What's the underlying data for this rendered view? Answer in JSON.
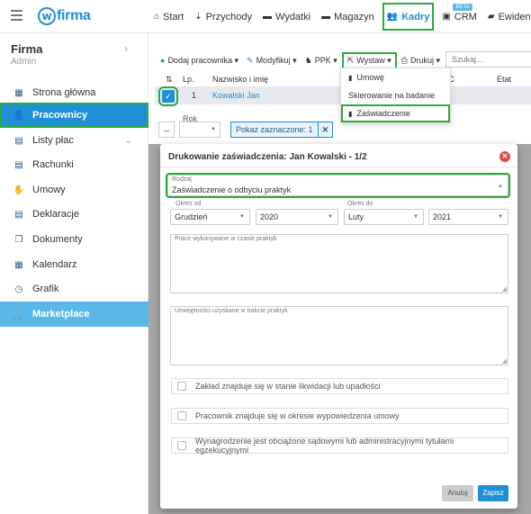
{
  "logo": {
    "text": "firma"
  },
  "topnav": [
    {
      "label": "Start",
      "icon": "home-icon",
      "glyph": "⌂"
    },
    {
      "label": "Przychody",
      "icon": "income-icon",
      "glyph": "⇣"
    },
    {
      "label": "Wydatki",
      "icon": "expenses-icon",
      "glyph": "▬"
    },
    {
      "label": "Magazyn",
      "icon": "warehouse-icon",
      "glyph": "▬"
    },
    {
      "label": "Kadry",
      "icon": "users-icon",
      "glyph": "👥"
    },
    {
      "label": "CRM",
      "icon": "crm-icon",
      "glyph": "▣"
    },
    {
      "label": "Ewidencje",
      "icon": "folder-icon",
      "glyph": "▰"
    }
  ],
  "beta_label": "BETA",
  "sidebar": {
    "company": "Firma",
    "role": "Admin",
    "items": [
      {
        "label": "Strona główna",
        "glyph": "▦"
      },
      {
        "label": "Pracownicy",
        "glyph": "👤"
      },
      {
        "label": "Listy płac",
        "glyph": "▤"
      },
      {
        "label": "Rachunki",
        "glyph": "▤"
      },
      {
        "label": "Umowy",
        "glyph": "✋"
      },
      {
        "label": "Deklaracje",
        "glyph": "▤"
      },
      {
        "label": "Dokumenty",
        "glyph": "❐"
      },
      {
        "label": "Kalendarz",
        "glyph": "▦"
      },
      {
        "label": "Grafik",
        "glyph": "◷"
      },
      {
        "label": "Marketplace",
        "glyph": "🛒"
      }
    ]
  },
  "toolbar": {
    "add_employee": "Dodaj pracownika",
    "modify": "Modyfikuj",
    "ppk": "PPK",
    "issue": "Wystaw",
    "print": "Drukuj",
    "search_placeholder": "Szukaj..."
  },
  "issue_menu": [
    "Umowę",
    "Skierowanie na badanie",
    "Zaświadczenie"
  ],
  "table": {
    "headers": [
      "Lp.",
      "Nazwisko i imię",
      "Etat"
    ],
    "c_partial": "C",
    "rows": [
      {
        "lp": "1",
        "name": "Kowalski Jan"
      }
    ]
  },
  "filters": {
    "year_label": "Rok",
    "show_selected": "Pokaż zaznaczone: 1"
  },
  "modal": {
    "title": "Drukowanie zaświadczenia: Jan Kowalski - 1/2",
    "type_label": "Rodzaj",
    "type_value": "Zaświadczenie o odbyciu praktyk",
    "period_from_label": "Okres od",
    "period_to_label": "Okres do",
    "from_month": "Grudzień",
    "from_year": "2020",
    "to_month": "Luty",
    "to_year": "2021",
    "work_label": "Prace wykonywane w czasie praktyk",
    "skills_label": "Umiejętności uzyskane w trakcie praktyk",
    "checks": [
      "Zakład znajduje się w stanie likwidacji lub upadłości",
      "Pracownik znajduje się w okresie wypowiedzenia umowy",
      "Wynagrodzenie jest obciążone sądowymi lub administracyjnymi tytułami egzekucyjnymi"
    ],
    "cancel": "Anuluj",
    "save": "Zapisz"
  }
}
